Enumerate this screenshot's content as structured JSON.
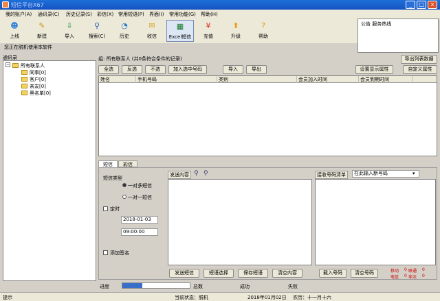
{
  "app": {
    "title": "短信平台X67"
  },
  "menu": [
    "我的账户(A)",
    "通讯录(C)",
    "历史记录(S)",
    "彩信(X)",
    "常用短语(P)",
    "界面(I)",
    "常用功能(G)",
    "帮助(H)"
  ],
  "toolbar": [
    {
      "label": "上线",
      "icon": "person-icon",
      "glyph": "☻",
      "color": "#2d7fd8"
    },
    {
      "label": "新建",
      "icon": "pencil-icon",
      "glyph": "✎",
      "color": "#c79a1c"
    },
    {
      "label": "导入",
      "icon": "import-icon",
      "glyph": "⇩",
      "color": "#1f9b3a"
    },
    {
      "label": "搜索(C)",
      "icon": "search-icon",
      "glyph": "⚲",
      "color": "#2b5fc0"
    },
    {
      "label": "历史",
      "icon": "history-icon",
      "glyph": "◔",
      "color": "#1d75c8"
    },
    {
      "label": "收信",
      "icon": "inbox-icon",
      "glyph": "✉",
      "color": "#d8a21c"
    },
    {
      "label": "Excel短信",
      "icon": "excel-icon",
      "glyph": "▦",
      "color": "#1c7a2c"
    },
    {
      "label": "充值",
      "icon": "yuan-icon",
      "glyph": "¥",
      "color": "#d62b1f"
    },
    {
      "label": "升级",
      "icon": "upgrade-icon",
      "glyph": "⬆",
      "color": "#e79b16"
    },
    {
      "label": "帮助",
      "icon": "help-icon",
      "glyph": "?",
      "color": "#d69a10"
    }
  ],
  "announce": {
    "label": "公告  服务热线"
  },
  "offline_notice": "您正在脱机使用本软件",
  "contacts": {
    "header": "通讯录",
    "root": "所有联系人",
    "groups": [
      "同事[0]",
      "客户[0]",
      "亲友[0]",
      "黑名单[0]"
    ]
  },
  "group_info": "组:  所有联系人 (共0条符合条件的记录)",
  "export_btn": "导出列表数据",
  "list_buttons": [
    "全选",
    "反选",
    "不选",
    "加入选中号码",
    "导入",
    "导出"
  ],
  "display_btn": "设置显示属性",
  "custom_btn": "自定义属性",
  "columns": [
    "姓名",
    "手机号码",
    "类别",
    "会员加入时间",
    "会员到期时间"
  ],
  "tabs": [
    "短信",
    "彩信"
  ],
  "sms": {
    "type_label": "短信类型",
    "opt1": "一对多短信",
    "opt2": "一对一短信",
    "timer_label": "定时",
    "date": "2018-01-03",
    "time": "09:00:00",
    "sign_label": "添加签名",
    "content_label": "发送内容",
    "recv_label": "接收号码清单",
    "recv_input": "在此输入新号码",
    "buttons": [
      "发送短信",
      "短语选择",
      "保存短语",
      "清空内容"
    ],
    "recv_buttons": [
      "载入号码",
      "清空号码"
    ],
    "counts": [
      "移动",
      "0",
      "联通",
      "0",
      "电信",
      "0",
      "非法",
      "0"
    ]
  },
  "progress": {
    "label": "进度",
    "total": "总数",
    "success": "成功",
    "fail": "失败",
    "fill": 0.3
  },
  "status": {
    "hint": "提示",
    "state": "当前状态：脱机",
    "date": "2018年01月02日",
    "lunar": "农历：十一月十六"
  }
}
